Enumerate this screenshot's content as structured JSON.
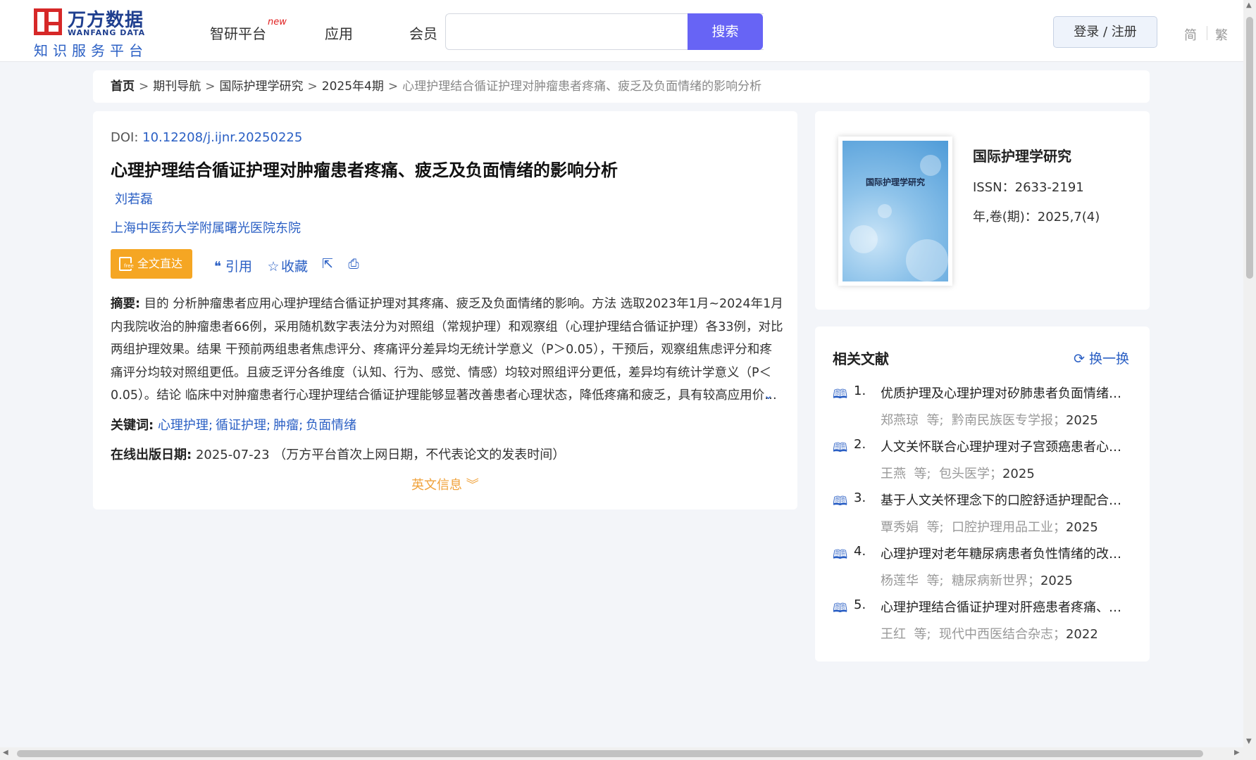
{
  "header": {
    "logo_cn": "万方数据",
    "logo_en": "WANFANG DATA",
    "logo_sub": "知识服务平台",
    "nav": [
      {
        "label": "智研平台",
        "badge": "new"
      },
      {
        "label": "应用"
      },
      {
        "label": "会员"
      }
    ],
    "search_value": "",
    "search_button": "搜索",
    "login": "登录 / 注册",
    "lang_simplified": "简",
    "lang_traditional": "繁"
  },
  "breadcrumb": {
    "home": "首页",
    "items": [
      "期刊导航",
      "国际护理学研究",
      "2025年4期"
    ],
    "current": "心理护理结合循证护理对肿瘤患者疼痛、疲乏及负面情绪的影响分析"
  },
  "article": {
    "doi_label": "DOI:",
    "doi": "10.12208/j.ijnr.20250225",
    "title": "心理护理结合循证护理对肿瘤患者疼痛、疲乏及负面情绪的影响分析",
    "author": "刘若磊",
    "organization": "上海中医药大学附属曙光医院东院",
    "fulltext_button": "全文直达",
    "cite_label": "引用",
    "collect_label": "收藏",
    "abstract_label": "摘要:",
    "abstract": "目的 分析肿瘤患者应用心理护理结合循证护理对其疼痛、疲乏及负面情绪的影响。方法 选取2023年1月~2024年1月内我院收治的肿瘤患者66例，采用随机数字表法分为对照组（常规护理）和观察组（心理护理结合循证护理）各33例，对比两组护理效果。结果 干预前两组患者焦虑评分、疼痛评分差异均无统计学意义（P＞0.05），干预后，观察组焦虑评分和疼痛评分均较对照组更低。且疲乏评分各维度（认知、行为、感觉、情感）均较对照组评分更低，差异均有统计学意义（P＜0.05）。结论 临床中对肿瘤患者行心理护理结合循证护理能够显著改善患者心理状态，降低疼痛和疲乏，具有较高应用价值。",
    "keywords_label": "关键词:",
    "keywords": [
      "心理护理",
      "循证护理",
      "肿瘤",
      "负面情绪"
    ],
    "pubdate_label": "在线出版日期:",
    "pubdate": "2025-07-23",
    "pubdate_note": "（万方平台首次上网日期，不代表论文的发表时间）",
    "english_info": "英文信息"
  },
  "journal": {
    "cover_title": "国际护理学研究",
    "name": "国际护理学研究",
    "issn": "ISSN：2633-2191",
    "volume": "年,卷(期)：2025,7(4)"
  },
  "related": {
    "title": "相关文献",
    "refresh": "换一换",
    "items": [
      {
        "num": "1.",
        "title": "优质护理及心理护理对矽肺患者负面情绪与生活质量的影响",
        "author": "郑燕琼",
        "etal": "等;",
        "source": "黔南民族医专学报；",
        "year": "2025"
      },
      {
        "num": "2.",
        "title": "人文关怀联合心理护理对子宫颈癌患者心理状态的影响",
        "author": "王燕",
        "etal": "等;",
        "source": "包头医学；",
        "year": "2025"
      },
      {
        "num": "3.",
        "title": "基于人文关怀理念下的口腔舒适护理配合心理护理的效果",
        "author": "覃秀娟",
        "etal": "等;",
        "source": "口腔护理用品工业；",
        "year": "2025"
      },
      {
        "num": "4.",
        "title": "心理护理对老年糖尿病患者负性情绪的改善效果分析",
        "author": "杨莲华",
        "etal": "等;",
        "source": "糖尿病新世界；",
        "year": "2025"
      },
      {
        "num": "5.",
        "title": "心理护理结合循证护理对肝癌患者疼痛、疲乏的影响",
        "author": "王红",
        "etal": "等;",
        "source": "现代中西医结合杂志；",
        "year": "2022"
      }
    ]
  }
}
